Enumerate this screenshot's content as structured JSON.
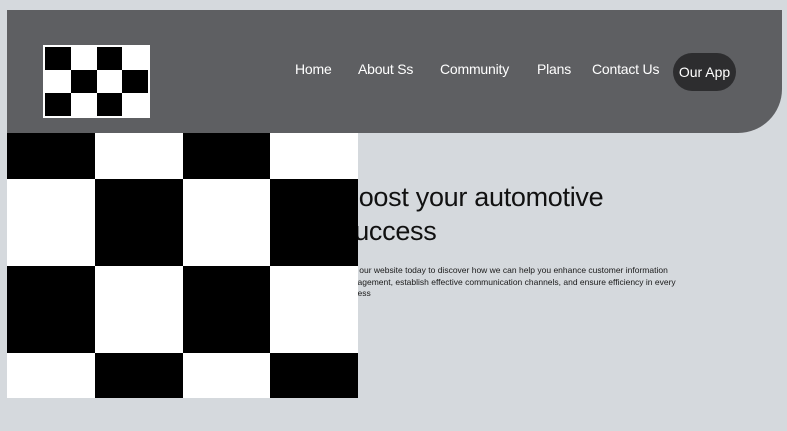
{
  "header": {
    "nav": [
      {
        "label": "Home"
      },
      {
        "label": "About Ss"
      },
      {
        "label": "Community"
      },
      {
        "label": "Plans"
      },
      {
        "label": "Contact Us"
      }
    ],
    "app_button_label": "Our App",
    "colors": {
      "header_bg": "#5e5f62",
      "button_bg": "#2d2d2f",
      "page_bg": "#d5d9dd"
    }
  },
  "hero": {
    "headline": "Boost your automotive success",
    "description": "Visit our website today to discover how we can help you enhance customer information management, establish effective communication channels, and ensure efficiency in every process",
    "image_icon": "checkerboard-pattern"
  }
}
